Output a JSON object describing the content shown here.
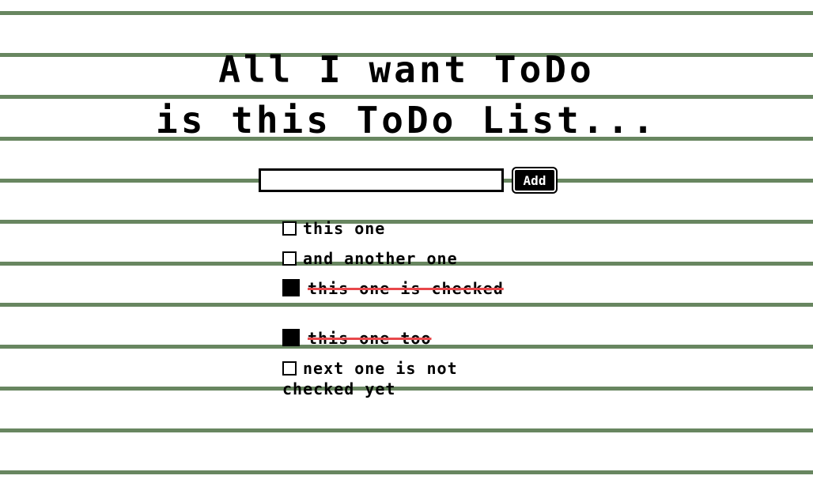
{
  "title": {
    "line1": "All I want ToDo",
    "line2": "is this ToDo List..."
  },
  "form": {
    "input_value": "",
    "input_placeholder": "",
    "add_label": "Add"
  },
  "todos": [
    {
      "text": "this one",
      "checked": false
    },
    {
      "text": "and another one",
      "checked": false
    },
    {
      "text": "this one is checked",
      "checked": true
    },
    {
      "text": "this one too",
      "checked": true
    },
    {
      "text": "next one is not checked yet",
      "checked": false
    }
  ],
  "colors": {
    "rule": "#688660",
    "strike": "#e8474a"
  }
}
